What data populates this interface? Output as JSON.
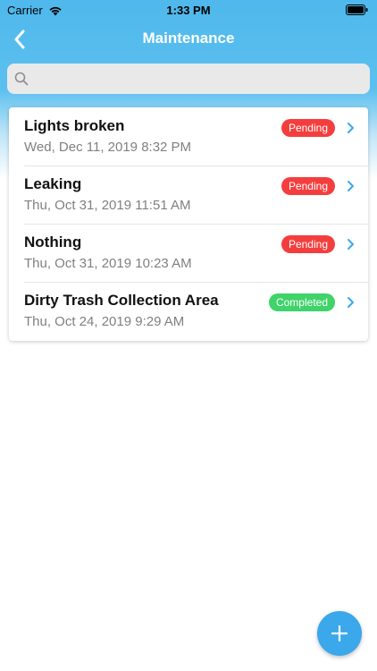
{
  "status_bar": {
    "carrier": "Carrier",
    "time": "1:33 PM"
  },
  "nav": {
    "title": "Maintenance",
    "back_icon": "chevron-left-icon"
  },
  "search": {
    "placeholder": "",
    "value": ""
  },
  "requests": [
    {
      "title": "Lights broken",
      "date": "Wed, Dec 11, 2019 8:32 PM",
      "status": "Pending"
    },
    {
      "title": "Leaking",
      "date": "Thu, Oct 31, 2019 11:51 AM",
      "status": "Pending"
    },
    {
      "title": "Nothing",
      "date": "Thu, Oct 31, 2019 10:23 AM",
      "status": "Pending"
    },
    {
      "title": "Dirty Trash Collection Area",
      "date": "Thu, Oct 24, 2019 9:29 AM",
      "status": "Completed"
    }
  ],
  "colors": {
    "accent": "#3aa8ea",
    "pending": "#f43e3e",
    "completed": "#3fd36a",
    "chevron": "#3aa8ea"
  },
  "fab": {
    "icon": "plus-icon"
  }
}
